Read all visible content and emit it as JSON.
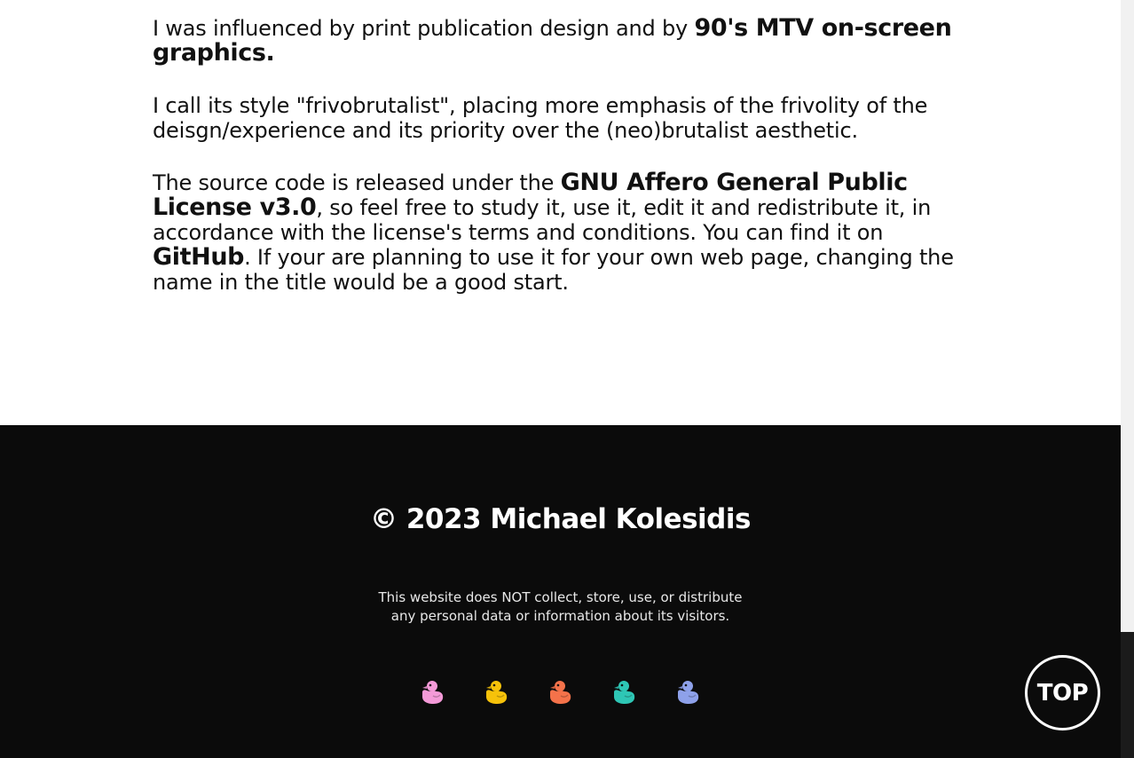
{
  "about": {
    "p1": {
      "text": "I was influenced by print publication design and by ",
      "bold": "90's MTV on-screen graphics."
    },
    "p2": {
      "text": "I call its style \"frivobrutalist\", placing more emphasis of the frivolity of the deisgn/experience and its priority over the (neo)brutalist aesthetic."
    },
    "p3": {
      "text_before": "The source code is released under the ",
      "license_link": "GNU Affero General Public License v3.0",
      "text_middle": ", so feel free to study it, use it, edit it and redistribute it, in accordance with the license's terms and conditions. You can find it on ",
      "github_link": "GitHub",
      "text_after": ". If your are planning to use it for your own web page, changing the name in the title would be a good start."
    }
  },
  "footer": {
    "copyright": "© 2023 Michael Kolesidis",
    "privacy_line1": "This website does NOT collect, store, use, or distribute",
    "privacy_line2": "any personal data or information about its visitors.",
    "ducks": [
      {
        "icon": "duck-icon",
        "color": "#f49ad8"
      },
      {
        "icon": "duck-icon",
        "color": "#f6c20a"
      },
      {
        "icon": "duck-icon",
        "color": "#f4724a"
      },
      {
        "icon": "duck-icon",
        "color": "#2ec6b5"
      },
      {
        "icon": "duck-icon",
        "color": "#8ea1ea"
      }
    ]
  },
  "top_button": {
    "label": "TOP"
  },
  "colors": {
    "background": "#ffffff",
    "footer": "#0b0b0b",
    "text": "#111111"
  }
}
